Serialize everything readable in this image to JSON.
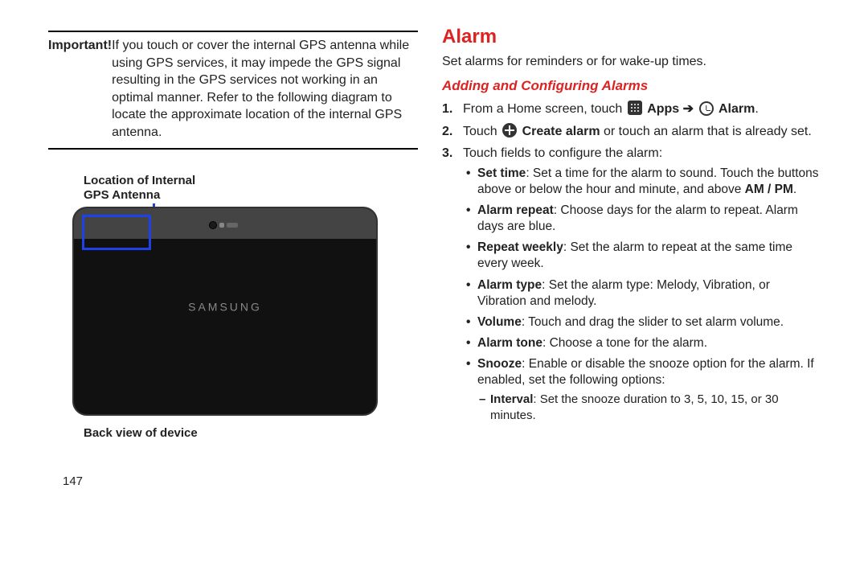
{
  "left": {
    "important_label": "Important! ",
    "important_text": "If you touch or cover the internal GPS antenna while using GPS services, it may impede the GPS signal resulting in the GPS services not working in an optimal manner. Refer to the following diagram to locate the approximate location of the internal GPS antenna.",
    "gps_label_line1": "Location of Internal",
    "gps_label_line2": "GPS Antenna",
    "brand": "SAMSUNG",
    "back_label": "Back view of device",
    "page_num": "147"
  },
  "right": {
    "h1": "Alarm",
    "intro": "Set alarms for reminders or for wake-up times.",
    "h2": "Adding and Configuring Alarms",
    "step1_pre": "From a Home screen, touch ",
    "step1_apps": "Apps",
    "step1_arrow": " ➔ ",
    "step1_alarm": "Alarm",
    "step1_end": ".",
    "step2_pre": "Touch ",
    "step2_create": "Create alarm",
    "step2_post": " or touch an alarm that is already set.",
    "step3": "Touch fields to configure the alarm:",
    "bullets": {
      "settime_b": "Set time",
      "settime_t": ": Set a time for the alarm to sound. Touch the buttons above or below the hour and minute, and above ",
      "ampm": "AM / PM",
      "settime_end": ".",
      "alarmrepeat_b": "Alarm repeat",
      "alarmrepeat_t": ": Choose days for the alarm to repeat. Alarm days are blue.",
      "repeatweekly_b": "Repeat weekly",
      "repeatweekly_t": ": Set the alarm to repeat at the same time every week.",
      "alarmtype_b": "Alarm type",
      "alarmtype_t": ": Set the alarm type: Melody, Vibration, or Vibration and melody.",
      "volume_b": "Volume",
      "volume_t": ": Touch and drag the slider to set alarm volume.",
      "alarmtone_b": "Alarm tone",
      "alarmtone_t": ": Choose a tone for the alarm.",
      "snooze_b": "Snooze",
      "snooze_t": ": Enable or disable the snooze option for the alarm. If enabled, set the following options:",
      "interval_b": "Interval",
      "interval_t": ": Set the snooze duration to 3, 5, 10, 15, or 30 minutes."
    }
  }
}
